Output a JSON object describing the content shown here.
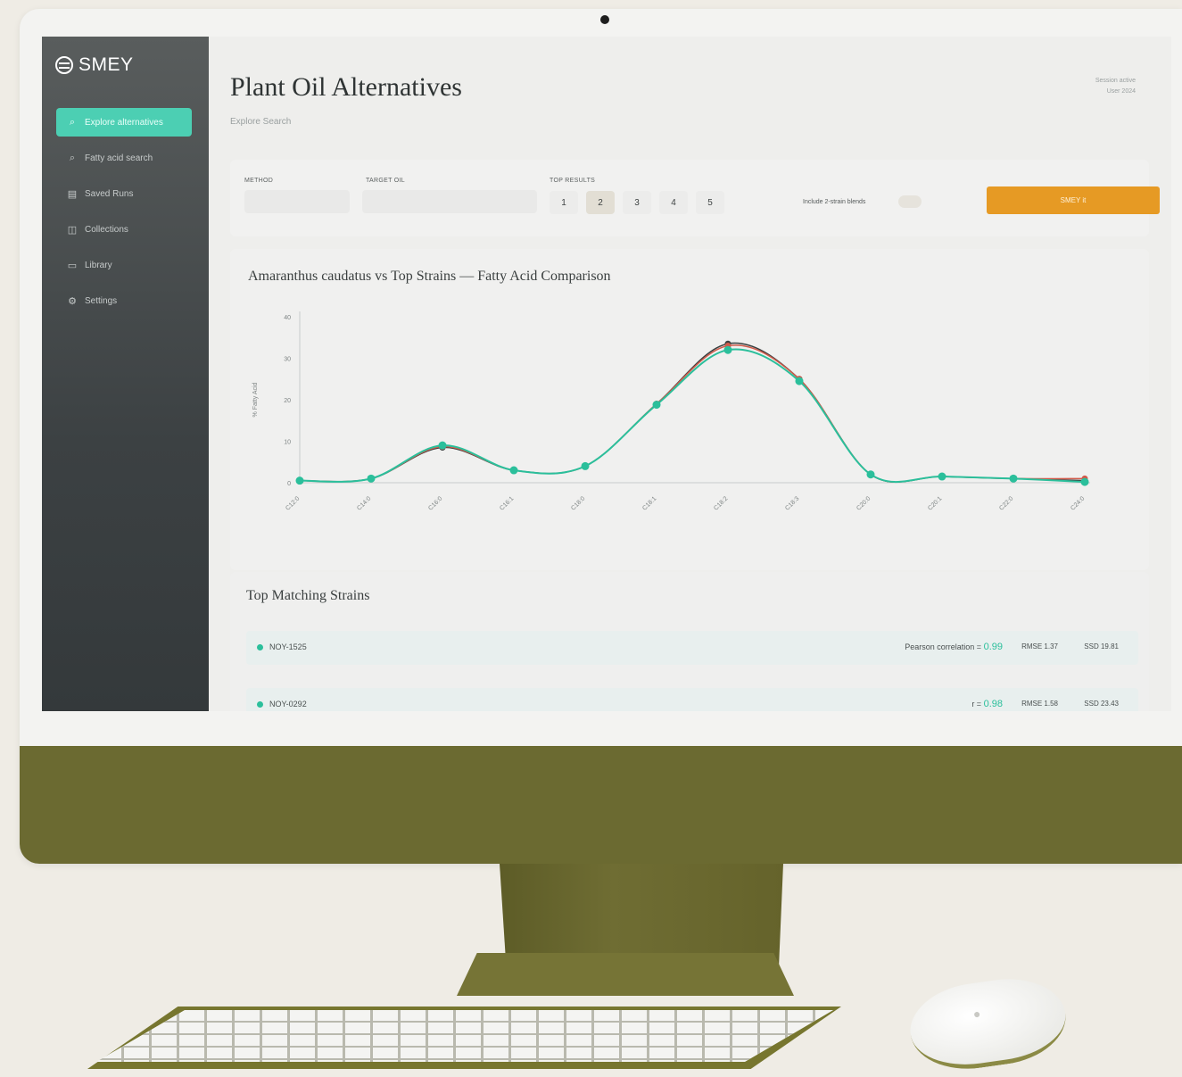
{
  "app": {
    "logo_text": "SMEY",
    "page_title": "Plant Oil Alternatives",
    "breadcrumb": "Explore Search",
    "session_line1": "Session active",
    "session_line2": "User 2024"
  },
  "sidebar": {
    "items": [
      {
        "label": "Explore alternatives",
        "icon": "search-icon"
      },
      {
        "label": "Fatty acid search",
        "icon": "search-icon"
      },
      {
        "label": "Saved Runs",
        "icon": "document-icon"
      },
      {
        "label": "Collections",
        "icon": "layers-icon"
      },
      {
        "label": "Library",
        "icon": "book-icon"
      },
      {
        "label": "Settings",
        "icon": "gear-icon"
      }
    ]
  },
  "filters": {
    "method_label": "METHOD",
    "method_value": "",
    "target_label": "TARGET OIL",
    "target_value": "",
    "top_label": "TOP RESULTS",
    "top_options": [
      "1",
      "2",
      "3",
      "4",
      "5"
    ],
    "top_selected": "2",
    "blend_label": "Include 2-strain blends",
    "submit_label": "SMEY it"
  },
  "colors": {
    "accent": "#2bbf9b",
    "target_line": "#3a3f3f",
    "secondary_line": "#d05a4a",
    "button": "#e69a24"
  },
  "chart_data": {
    "type": "line",
    "title": "Amaranthus caudatus vs Top Strains — Fatty Acid Comparison",
    "ylabel": "% Fatty Acid",
    "xlabel": "",
    "ylim": [
      0,
      40
    ],
    "yticks": [
      "0",
      "10",
      "20",
      "30",
      "40"
    ],
    "categories": [
      "C12:0",
      "C14:0",
      "C16:0",
      "C16:1",
      "C18:0",
      "C18:1",
      "C18:2",
      "C18:3",
      "C20:0",
      "C20:1",
      "C22:0",
      "C24:0"
    ],
    "series": [
      {
        "color": "#3a3f3f",
        "values": [
          0.5,
          1,
          8.5,
          3,
          4,
          19,
          33.5,
          25,
          2,
          1.5,
          1,
          0.5
        ]
      },
      {
        "color": "#d05a4a",
        "values": [
          0.5,
          1,
          8.7,
          3,
          4,
          19,
          33,
          25,
          2,
          1.5,
          1,
          1
        ]
      },
      {
        "color": "#2bbf9b",
        "values": [
          0.5,
          1,
          9,
          3,
          4,
          18.8,
          32,
          24.5,
          2,
          1.5,
          1,
          0.2
        ]
      }
    ],
    "grid": false
  },
  "results": {
    "title": "Top Matching Strains",
    "rows": [
      {
        "name": "NOY-1525",
        "corr_label": "Pearson correlation = ",
        "corr_value": "0.99",
        "rmse": "RMSE 1.37",
        "ssd": "SSD 19.81"
      },
      {
        "name": "NOY-0292",
        "corr_label": "r = ",
        "corr_value": "0.98",
        "rmse": "RMSE 1.58",
        "ssd": "SSD 23.43"
      }
    ]
  }
}
